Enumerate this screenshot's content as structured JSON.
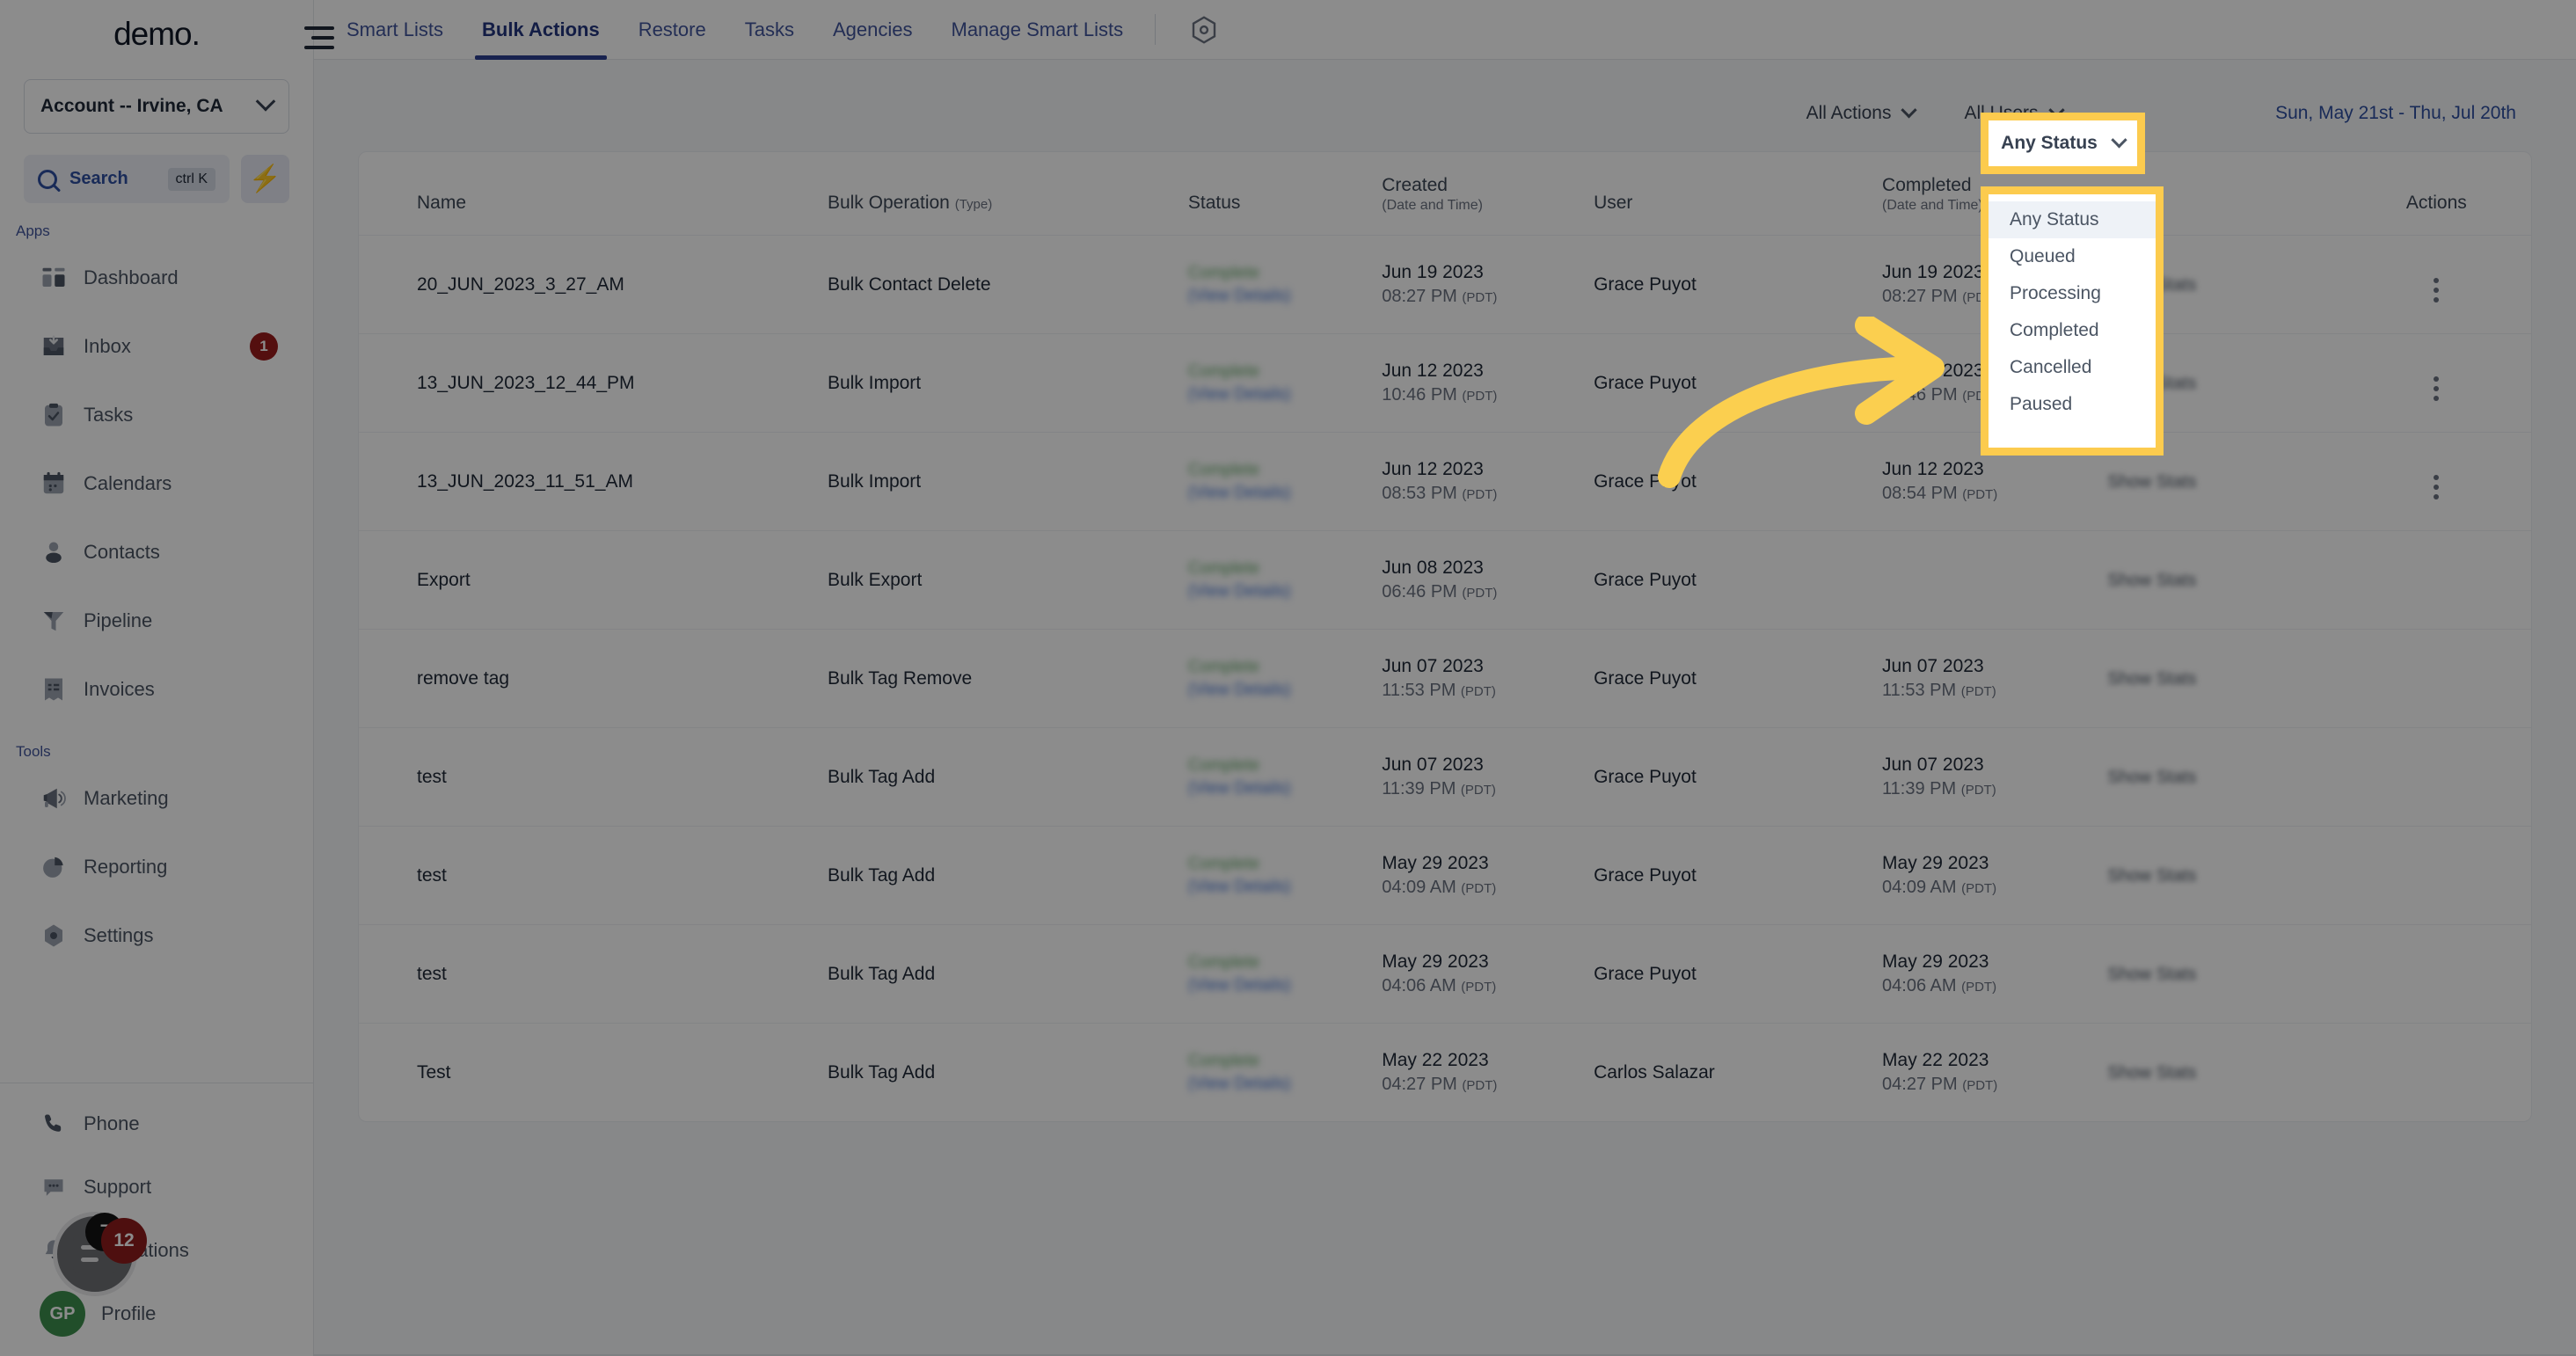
{
  "sidebar": {
    "logo": "demo",
    "account_selector": {
      "label": "Account -- Irvine, CA",
      "icon": "chevron-down-icon"
    },
    "search": {
      "label": "Search",
      "shortcut": "ctrl K",
      "icon": "search-icon"
    },
    "quick_action_icon": "bolt-icon",
    "sections": [
      {
        "label": "Apps",
        "items": [
          {
            "label": "Dashboard",
            "icon": "dashboard-icon",
            "badge": ""
          },
          {
            "label": "Inbox",
            "icon": "inbox-icon",
            "badge": "1"
          },
          {
            "label": "Tasks",
            "icon": "tasks-icon",
            "badge": ""
          },
          {
            "label": "Calendars",
            "icon": "calendar-icon",
            "badge": ""
          },
          {
            "label": "Contacts",
            "icon": "contacts-icon",
            "badge": ""
          },
          {
            "label": "Pipeline",
            "icon": "pipeline-icon",
            "badge": ""
          },
          {
            "label": "Invoices",
            "icon": "invoices-icon",
            "badge": ""
          }
        ]
      },
      {
        "label": "Tools",
        "items": [
          {
            "label": "Marketing",
            "icon": "megaphone-icon",
            "badge": ""
          },
          {
            "label": "Reporting",
            "icon": "pie-chart-icon",
            "badge": ""
          },
          {
            "label": "Settings",
            "icon": "gear-icon",
            "badge": ""
          }
        ]
      }
    ],
    "bottom_items": [
      {
        "label": "Phone",
        "icon": "phone-icon"
      },
      {
        "label": "Support",
        "icon": "chat-dots-icon"
      },
      {
        "label": "Notifications",
        "icon": "bell-icon"
      },
      {
        "label": "Profile",
        "icon": "avatar-icon",
        "avatar_initials": "GP"
      }
    ],
    "chat_launcher": {
      "icon": "chat-bubble-icon",
      "badge_black": "7",
      "badge_red": "12"
    }
  },
  "topbar": {
    "tabs": [
      {
        "label": "Smart Lists",
        "active": false
      },
      {
        "label": "Bulk Actions",
        "active": true
      },
      {
        "label": "Restore",
        "active": false
      },
      {
        "label": "Tasks",
        "active": false
      },
      {
        "label": "Agencies",
        "active": false
      },
      {
        "label": "Manage Smart Lists",
        "active": false
      }
    ],
    "settings_icon": "gear-hex-icon"
  },
  "filters": {
    "actions": {
      "label": "All Actions",
      "icon": "chevron-down-icon"
    },
    "users": {
      "label": "All Users",
      "icon": "chevron-down-icon"
    },
    "status": {
      "label": "Any Status",
      "icon": "chevron-down-icon",
      "highlighted": true
    },
    "date_range": "Sun, May 21st - Thu, Jul 20th"
  },
  "status_dropdown": {
    "open": true,
    "selected": "Any Status",
    "options": [
      "Any Status",
      "Queued",
      "Processing",
      "Completed",
      "Cancelled",
      "Paused"
    ]
  },
  "table": {
    "columns": [
      {
        "label": "Name",
        "sub": ""
      },
      {
        "label": "Bulk Operation",
        "sub": "(Type)"
      },
      {
        "label": "Status",
        "sub": ""
      },
      {
        "label": "Created",
        "sub": "(Date and Time)"
      },
      {
        "label": "User",
        "sub": ""
      },
      {
        "label": "Completed",
        "sub": "(Date and Time)"
      },
      {
        "label": "",
        "sub": ""
      },
      {
        "label": "Actions",
        "sub": ""
      }
    ],
    "status_text": "Complete",
    "status_details_link": "(View Details)",
    "show_stats_label": "Show Stats",
    "rows": [
      {
        "name": "20_JUN_2023_3_27_AM",
        "operation": "Bulk Contact Delete",
        "created_date": "Jun 19 2023",
        "created_time": "08:27 PM",
        "created_tz": "(PDT)",
        "user": "Grace Puyot",
        "completed_date": "Jun 19 2023",
        "completed_time": "08:27 PM",
        "completed_tz": "(PDT)",
        "has_kebab": true
      },
      {
        "name": "13_JUN_2023_12_44_PM",
        "operation": "Bulk Import",
        "created_date": "Jun 12 2023",
        "created_time": "10:46 PM",
        "created_tz": "(PDT)",
        "user": "Grace Puyot",
        "completed_date": "Jun 12 2023",
        "completed_time": "10:46 PM",
        "completed_tz": "(PDT)",
        "has_kebab": true
      },
      {
        "name": "13_JUN_2023_11_51_AM",
        "operation": "Bulk Import",
        "created_date": "Jun 12 2023",
        "created_time": "08:53 PM",
        "created_tz": "(PDT)",
        "user": "Grace Puyot",
        "completed_date": "Jun 12 2023",
        "completed_time": "08:54 PM",
        "completed_tz": "(PDT)",
        "has_kebab": true
      },
      {
        "name": "Export",
        "operation": "Bulk Export",
        "created_date": "Jun 08 2023",
        "created_time": "06:46 PM",
        "created_tz": "(PDT)",
        "user": "Grace Puyot",
        "completed_date": "",
        "completed_time": "",
        "completed_tz": "",
        "has_kebab": false
      },
      {
        "name": "remove tag",
        "operation": "Bulk Tag Remove",
        "created_date": "Jun 07 2023",
        "created_time": "11:53 PM",
        "created_tz": "(PDT)",
        "user": "Grace Puyot",
        "completed_date": "Jun 07 2023",
        "completed_time": "11:53 PM",
        "completed_tz": "(PDT)",
        "has_kebab": false
      },
      {
        "name": "test",
        "operation": "Bulk Tag Add",
        "created_date": "Jun 07 2023",
        "created_time": "11:39 PM",
        "created_tz": "(PDT)",
        "user": "Grace Puyot",
        "completed_date": "Jun 07 2023",
        "completed_time": "11:39 PM",
        "completed_tz": "(PDT)",
        "has_kebab": false
      },
      {
        "name": "test",
        "operation": "Bulk Tag Add",
        "created_date": "May 29 2023",
        "created_time": "04:09 AM",
        "created_tz": "(PDT)",
        "user": "Grace Puyot",
        "completed_date": "May 29 2023",
        "completed_time": "04:09 AM",
        "completed_tz": "(PDT)",
        "has_kebab": false
      },
      {
        "name": "test",
        "operation": "Bulk Tag Add",
        "created_date": "May 29 2023",
        "created_time": "04:06 AM",
        "created_tz": "(PDT)",
        "user": "Grace Puyot",
        "completed_date": "May 29 2023",
        "completed_time": "04:06 AM",
        "completed_tz": "(PDT)",
        "has_kebab": false
      },
      {
        "name": "Test",
        "operation": "Bulk Tag Add",
        "created_date": "May 22 2023",
        "created_time": "04:27 PM",
        "created_tz": "(PDT)",
        "user": "Carlos Salazar",
        "completed_date": "May 22 2023",
        "completed_time": "04:27 PM",
        "completed_tz": "(PDT)",
        "has_kebab": false
      }
    ]
  },
  "annotation": {
    "arrow_icon": "curved-arrow-icon",
    "highlight_color": "#fccb4e"
  }
}
